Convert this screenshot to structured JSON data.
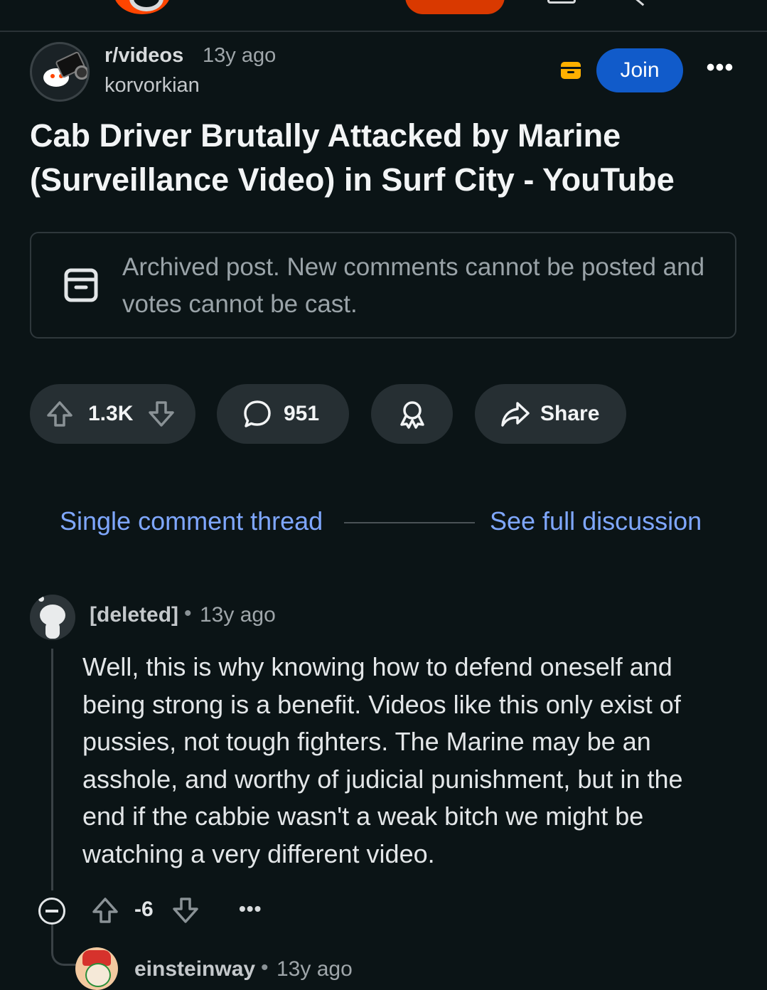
{
  "post": {
    "subreddit": "r/videos",
    "time": "13y ago",
    "author": "korvorkian",
    "join_label": "Join",
    "more_label": "•••",
    "title": "Cab Driver Brutally Attacked by Marine (Surveillance Video) in Surf City - YouTube",
    "archived_notice": "Archived post. New comments cannot be posted and votes cannot be cast."
  },
  "actions": {
    "score": "1.3K",
    "comments": "951",
    "share_label": "Share"
  },
  "thread_nav": {
    "single_thread": "Single comment thread",
    "full_discussion": "See full discussion"
  },
  "comment": {
    "author": "[deleted]",
    "separator": "•",
    "time": "13y ago",
    "body": "Well, this is why knowing how to defend oneself and being strong is a benefit. Videos like this only exist of pussies, not tough fighters. The Marine may be an asshole, and worthy of judicial punishment, but in the end if the cabbie wasn't a weak bitch we might be watching a very different video.",
    "score": "-6",
    "more_label": "•••"
  },
  "reply": {
    "author": "einsteinway",
    "separator": "•",
    "time": "13y ago"
  },
  "colors": {
    "background": "#0b1416",
    "join_button": "#115bca",
    "link": "#7fa7ff",
    "pill": "#262f33",
    "archive_badge": "#ffb000",
    "brand": "#ff4500"
  }
}
